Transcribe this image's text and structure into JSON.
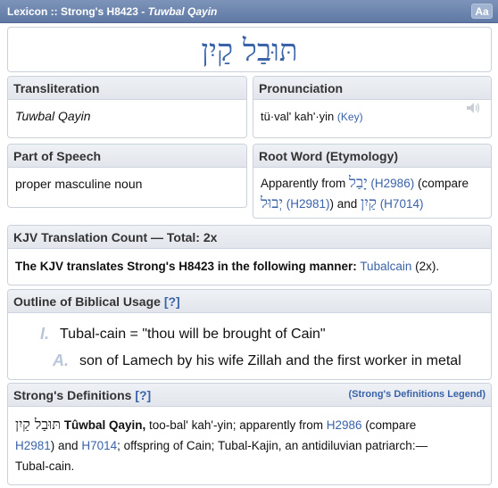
{
  "titlebar": {
    "prefix": "Lexicon :: Strong's H8423 - ",
    "italic": "Tuwbal Qayin",
    "aa_label": "Aa"
  },
  "headword": "תּוּבַל קַיִן",
  "transliteration": {
    "heading": "Transliteration",
    "value": "Tuwbal Qayin"
  },
  "pronunciation": {
    "heading": "Pronunciation",
    "value": "tü·val' kah'·yin",
    "key_label": "(Key)"
  },
  "part_of_speech": {
    "heading": "Part of Speech",
    "value": "proper masculine noun"
  },
  "root_word": {
    "heading": "Root Word (Etymology)",
    "line1_pre": "Apparently from ",
    "heb1": "יָבַל",
    "ref1": "(H2986)",
    "line1_post": " (compare",
    "heb2": "יְבוּל",
    "ref2": "(H2981)",
    "and": ") and ",
    "heb3": "קַיִן",
    "ref3": "(H7014)"
  },
  "kjv": {
    "heading": "KJV Translation Count — Total: 2x",
    "statement": "The KJV translates Strong's H8423 in the following manner:",
    "word": "Tubalcain",
    "count": "(2x)."
  },
  "outline": {
    "heading": "Outline of Biblical Usage",
    "help": "[?]",
    "items": [
      {
        "mark": "I.",
        "text": "Tubal-cain = \"thou will be brought of Cain\""
      },
      {
        "mark": "A.",
        "text": "son of Lamech by his wife Zillah and the first worker in metal"
      }
    ]
  },
  "strongs": {
    "heading": "Strong's Definitions",
    "help": "[?]",
    "legend": "(Strong's Definitions Legend)",
    "heb": "תּוּבַל קַיִן",
    "bold": "Tûwbal Qayin,",
    "text1": " too-bal' kah'-yin; apparently from ",
    "ref1": "H2986",
    "text2": " (compare",
    "ref2": "H2981",
    "text3": ") and ",
    "ref3": "H7014",
    "text4": "; offspring of Cain; Tubal-Kajin, an antidiluvian patriarch:—",
    "line3": "Tubal-cain."
  },
  "colors": {
    "accent": "#3a63a8",
    "title_bar": "#6b84ae",
    "panel_header": "#e6e9ee"
  }
}
